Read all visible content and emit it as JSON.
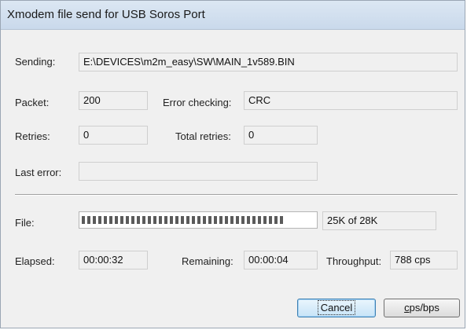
{
  "window": {
    "title": "Xmodem file send for USB Soros Port"
  },
  "sending": {
    "label": "Sending:",
    "value": "E:\\DEVICES\\m2m_easy\\SW\\MAIN_1v589.BIN"
  },
  "packet": {
    "label": "Packet:",
    "value": "200"
  },
  "error_checking": {
    "label": "Error checking:",
    "value": "CRC"
  },
  "retries": {
    "label": "Retries:",
    "value": "0"
  },
  "total_retries": {
    "label": "Total retries:",
    "value": "0"
  },
  "last_error": {
    "label": "Last error:",
    "value": ""
  },
  "file": {
    "label": "File:",
    "progress_fraction": 0.89,
    "status": "25K of 28K"
  },
  "elapsed": {
    "label": "Elapsed:",
    "value": "00:00:32"
  },
  "remaining": {
    "label": "Remaining:",
    "value": "00:00:04"
  },
  "throughput": {
    "label": "Throughput:",
    "value": "788 cps"
  },
  "buttons": {
    "cancel": "Cancel",
    "cps_accel": "c",
    "cps_rest": "ps/bps"
  },
  "colors": {
    "title_bar": "#c9d9eb",
    "dialog_bg": "#f0f0f0",
    "progress_block": "#5b5b5b",
    "default_button_border": "#3c7fb1"
  }
}
